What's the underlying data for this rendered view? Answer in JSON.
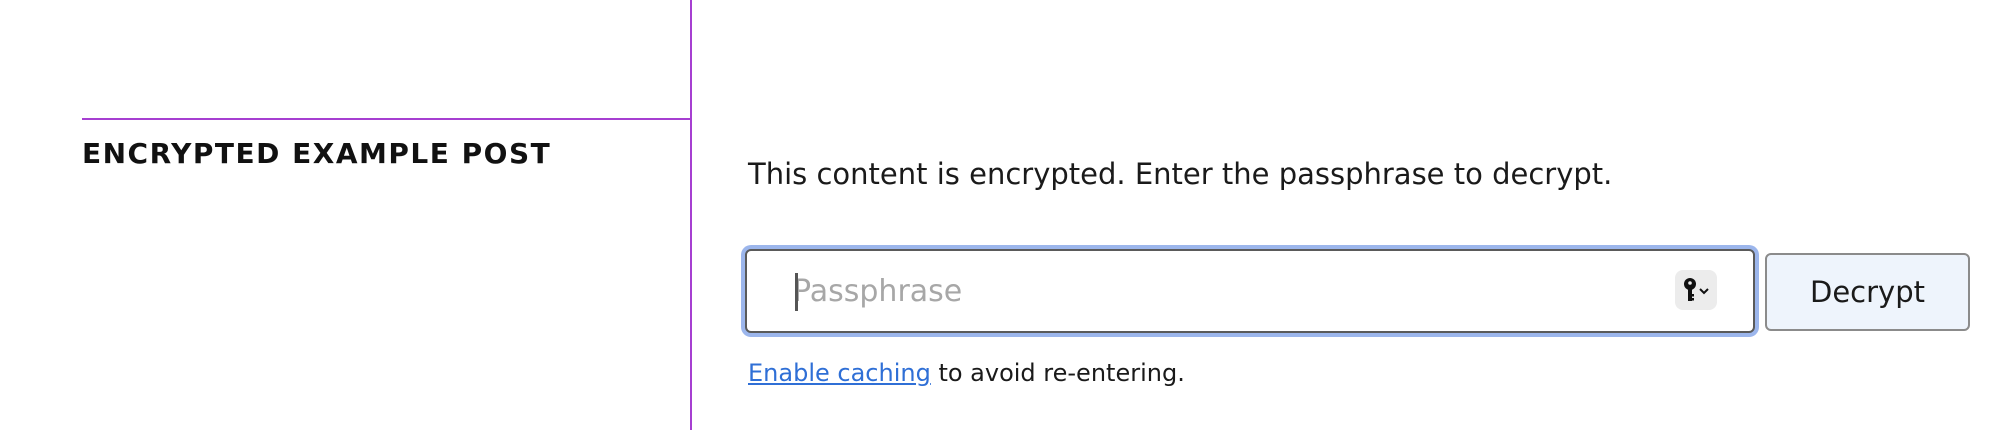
{
  "sidebar": {
    "post_title": "ENCRYPTED EXAMPLE POST"
  },
  "main": {
    "notice": "This content is encrypted. Enter the passphrase to decrypt.",
    "passphrase_input": {
      "placeholder": "Passphrase",
      "value": ""
    },
    "key_icon": "key-icon",
    "decrypt_label": "Decrypt",
    "caching": {
      "link_label": "Enable caching",
      "suffix": " to avoid re-entering."
    }
  },
  "colors": {
    "accent_divider": "#a63fd1",
    "focus_ring": "#9cb6ec",
    "link": "#2f6fd6",
    "button_bg": "#eef4fc"
  }
}
